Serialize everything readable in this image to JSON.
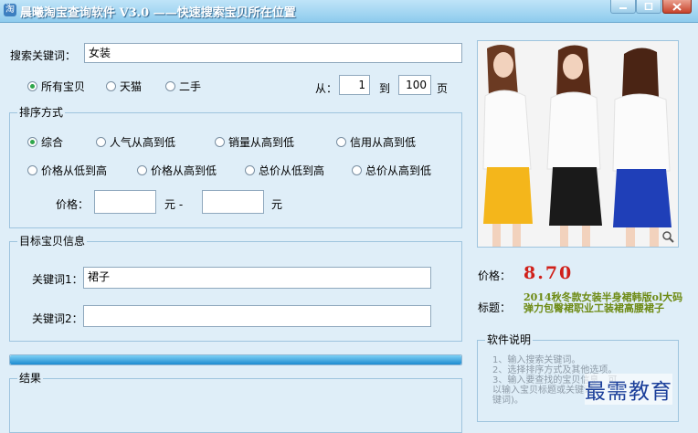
{
  "window": {
    "title": "晨曦淘宝查询软件 V3.0  ——快速搜索宝贝所在位置"
  },
  "search": {
    "keyword_label": "搜索关键词：",
    "keyword_value": "女装",
    "scope": {
      "all": "所有宝贝",
      "tmall": "天猫",
      "second_hand": "二手",
      "selected": "所有宝贝"
    },
    "pages": {
      "from_label": "从：",
      "from_value": "1",
      "to_label": "到",
      "to_value": "100",
      "unit": "页"
    }
  },
  "sort": {
    "title": "排序方式",
    "options": [
      "综合",
      "人气从高到低",
      "销量从高到低",
      "信用从高到低",
      "价格从低到高",
      "价格从高到低",
      "总价从低到高",
      "总价从高到低"
    ],
    "selected": "综合",
    "price_label": "价格：",
    "price_unit": "元 -",
    "price_unit2": "元",
    "price_min": "",
    "price_max": ""
  },
  "target": {
    "title": "目标宝贝信息",
    "kw1_label": "关键词1：",
    "kw1_value": "裙子",
    "kw2_label": "关键词2：",
    "kw2_value": ""
  },
  "progress": {
    "fraction": 1.0
  },
  "results": {
    "title": "结果"
  },
  "product": {
    "price_label": "价格：",
    "price": "8.70",
    "title_label": "标题：",
    "title": "2014秋冬款女装半身裙韩版ol大码弹力包臀裙职业工装裙高腰裙子"
  },
  "notes": {
    "title": "软件说明",
    "items": [
      "1、输入搜索关键词。",
      "2、选择排序方式及其他选项。",
      "3、输入要查找的宝贝信息，可",
      "以输入宝贝标题或关键词，",
      "键词)。"
    ]
  },
  "watermark": "最需教育",
  "colors": {
    "price": "#d0201a",
    "title": "#6d8a13",
    "accent": "#1c8ad0"
  }
}
